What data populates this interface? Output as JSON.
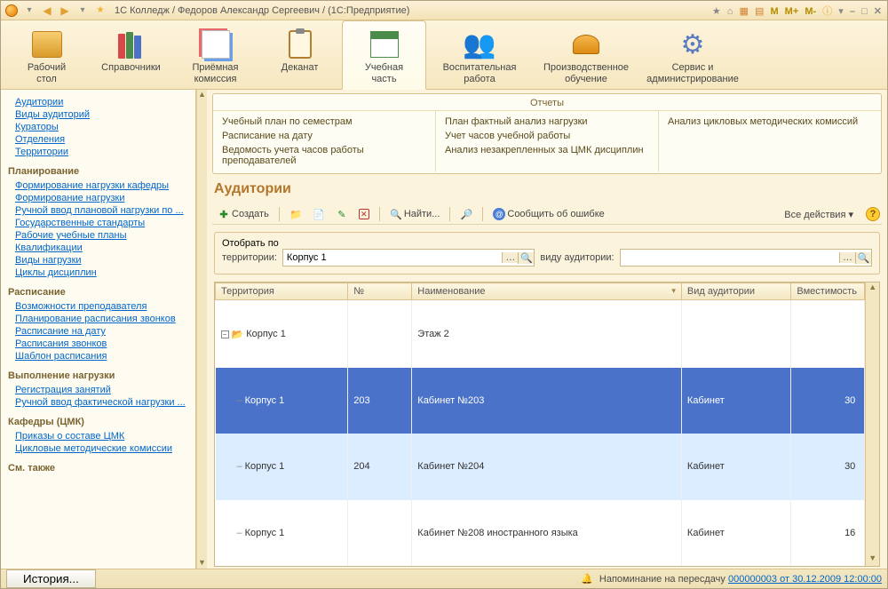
{
  "titlebar": {
    "title": "1С Колледж / Федоров Александр Сергеевич / (1С:Предприятие)",
    "right_labels": {
      "m": "M",
      "mplus": "M+",
      "mminus": "M-"
    }
  },
  "maintabs": [
    {
      "label": "Рабочий\nстол"
    },
    {
      "label": "Справочники"
    },
    {
      "label": "Приёмная\nкомиссия"
    },
    {
      "label": "Деканат"
    },
    {
      "label": "Учебная\nчасть",
      "active": true
    },
    {
      "label": "Воспитательная\nработа"
    },
    {
      "label": "Производственное\nобучение"
    },
    {
      "label": "Сервис и\nадминистрирование"
    }
  ],
  "sidebar": {
    "top_links": [
      "Аудитории",
      "Виды аудиторий",
      "Кураторы",
      "Отделения",
      "Территории"
    ],
    "groups": [
      {
        "title": "Планирование",
        "links": [
          "Формирование нагрузки кафедры",
          "Формирование нагрузки",
          "Ручной ввод плановой нагрузки по ...",
          "Государственные стандарты",
          "Рабочие учебные планы",
          "Квалификации",
          "Виды нагрузки",
          "Циклы дисциплин"
        ]
      },
      {
        "title": "Расписание",
        "links": [
          "Возможности преподавателя",
          "Планирование расписания звонков",
          "Расписание на дату",
          "Расписания звонков",
          "Шаблон расписания"
        ]
      },
      {
        "title": "Выполнение нагрузки",
        "links": [
          "Регистрация занятий",
          "Ручной ввод фактической нагрузки ..."
        ]
      },
      {
        "title": "Кафедры (ЦМК)",
        "links": [
          "Приказы о составе ЦМК",
          "Цикловые методические комиссии"
        ]
      },
      {
        "title": "См. также",
        "links": []
      }
    ]
  },
  "reports": {
    "title": "Отчеты",
    "cols": [
      [
        "Учебный план по семестрам",
        "Расписание на дату",
        "Ведомость учета часов работы преподавателей"
      ],
      [
        "План фактный анализ нагрузки",
        "Учет часов учебной работы",
        "Анализ незакрепленных за ЦМК дисциплин"
      ],
      [
        "Анализ цикловых методических комиссий"
      ]
    ]
  },
  "page": {
    "title": "Аудитории",
    "create": "Создать",
    "find": "Найти...",
    "report_bug": "Сообщить об ошибке",
    "all_actions": "Все действия"
  },
  "filter": {
    "legend": "Отобрать по",
    "territory_label": "территории:",
    "territory_value": "Корпус 1",
    "type_label": "виду аудитории:",
    "type_value": ""
  },
  "table": {
    "headers": [
      "Территория",
      "№",
      "Наименование",
      "Вид аудитории",
      "Вместимость"
    ],
    "rows": [
      {
        "territory": "Корпус 1",
        "num": "",
        "name": "Этаж 2",
        "kind": "",
        "cap": "",
        "level": 0,
        "expanded": true
      },
      {
        "territory": "Корпус 1",
        "num": "203",
        "name": "Кабинет №203",
        "kind": "Кабинет",
        "cap": "30",
        "level": 1,
        "selected": true
      },
      {
        "territory": "Корпус 1",
        "num": "204",
        "name": "Кабинет №204",
        "kind": "Кабинет",
        "cap": "30",
        "level": 1,
        "highlight": true
      },
      {
        "territory": "Корпус 1",
        "num": "",
        "name": "Кабинет №208 иностранного языка",
        "kind": "Кабинет",
        "cap": "16",
        "level": 1
      }
    ]
  },
  "statusbar": {
    "history": "История...",
    "msg_prefix": "Напоминание на пересдачу ",
    "msg_link": "000000003 от 30.12.2009 12:00:00"
  }
}
